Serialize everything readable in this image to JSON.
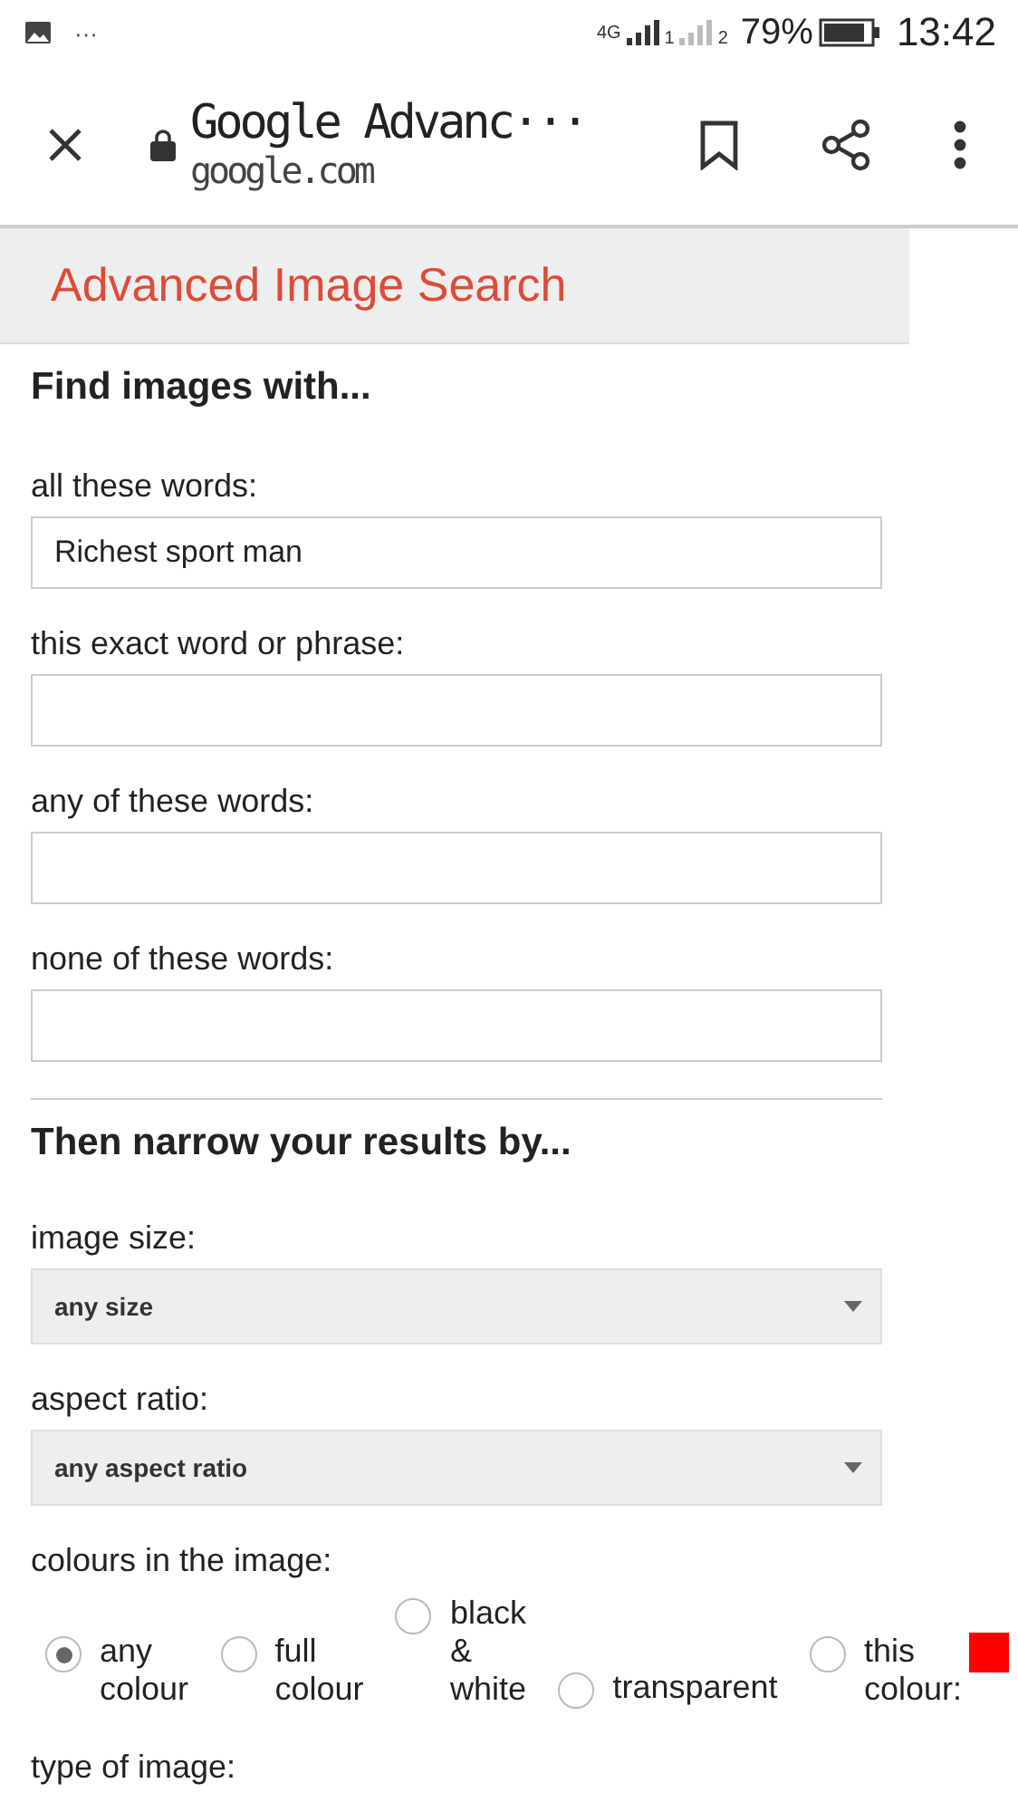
{
  "status_bar": {
    "notification_more": "···",
    "network": "4G",
    "sim_1": "1",
    "sim_2": "2",
    "battery": "79%",
    "time": "13:42"
  },
  "toolbar": {
    "title": "Google  Advanc···",
    "url": "google.com"
  },
  "page": {
    "heading": "Advanced Image Search",
    "find_section": {
      "title": "Find images with...",
      "fields": [
        {
          "label": "all these words:",
          "value": "Richest sport man"
        },
        {
          "label": "this exact word or phrase:"
        },
        {
          "label": "any of these words:"
        },
        {
          "label": "none of these words:"
        }
      ]
    },
    "narrow_section": {
      "title": "Then narrow your results by...",
      "selects": [
        {
          "label": "image size:",
          "value": "any size"
        },
        {
          "label": "aspect ratio:",
          "value": "any aspect ratio"
        }
      ],
      "colours": {
        "label": "colours in the image:",
        "options": [
          {
            "kind": "plain",
            "label": "any colour",
            "selected": true
          },
          {
            "kind": "plain",
            "label": "full colour",
            "selected": false
          },
          {
            "kind": "plain",
            "label": "black & white",
            "selected": false
          },
          {
            "kind": "plain",
            "label": "transparent",
            "selected": false
          },
          {
            "kind": "swatch",
            "label": "this colour:",
            "selected": false,
            "color": "#ff0000"
          }
        ]
      },
      "next_label": "type of image:"
    }
  }
}
